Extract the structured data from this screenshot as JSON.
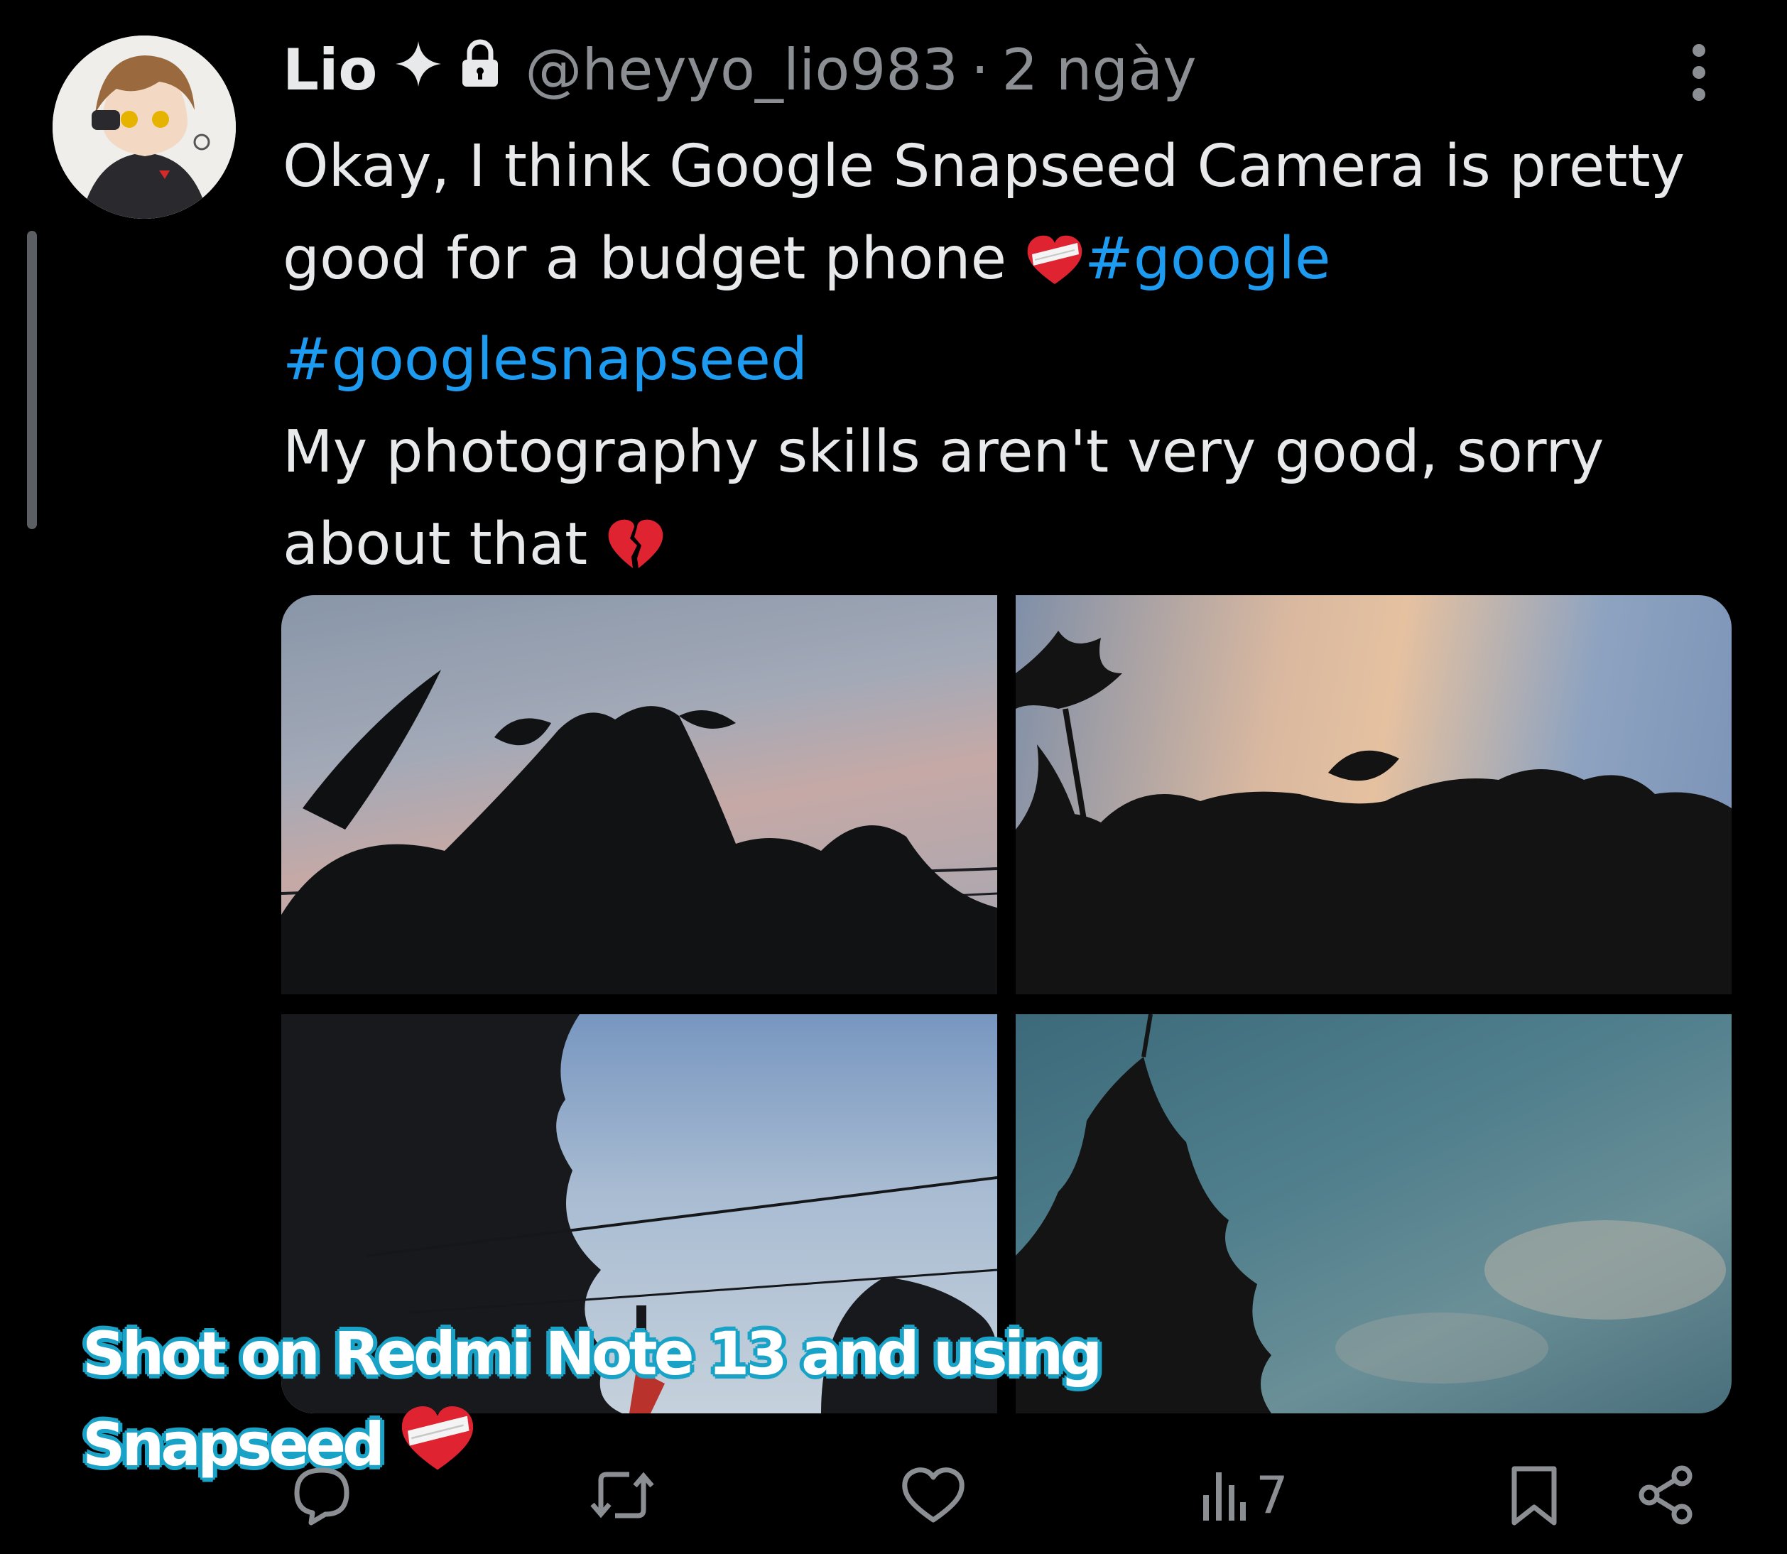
{
  "tweet": {
    "display_name": "Lio",
    "handle": "@heyyo_lio983",
    "separator": "·",
    "time": "2 ngày",
    "text_line1": "Okay, I think Google Snapseed Camera is pretty good for a budget phone ",
    "hashtag1": "#google",
    "hashtag2": "#googlesnapseed",
    "text_line2": "My photography skills aren't very good, sorry about that ",
    "emoji1": "mending-heart",
    "emoji2": "broken-heart"
  },
  "photos": [
    {
      "name": "photo-1",
      "desc": "leaves silhouette against pink clouds"
    },
    {
      "name": "photo-2",
      "desc": "leaves silhouette against golden cloud"
    },
    {
      "name": "photo-3",
      "desc": "trees and power lines against blue sky"
    },
    {
      "name": "photo-4",
      "desc": "foliage against teal sky"
    }
  ],
  "caption": {
    "line1": "Shot on Redmi Note 13 and using",
    "line2": "Snapseed "
  },
  "actions": {
    "reply_icon": "reply-icon",
    "retweet_icon": "retweet-icon",
    "like_icon": "heart-icon",
    "views_icon": "views-icon",
    "views_count": "7",
    "bookmark_icon": "bookmark-icon",
    "share_icon": "share-icon"
  },
  "colors": {
    "background": "#000000",
    "text": "#e7e9ea",
    "muted": "#8b8f93",
    "link": "#1d9bf0",
    "caption_outline": "#1aa3c7"
  }
}
